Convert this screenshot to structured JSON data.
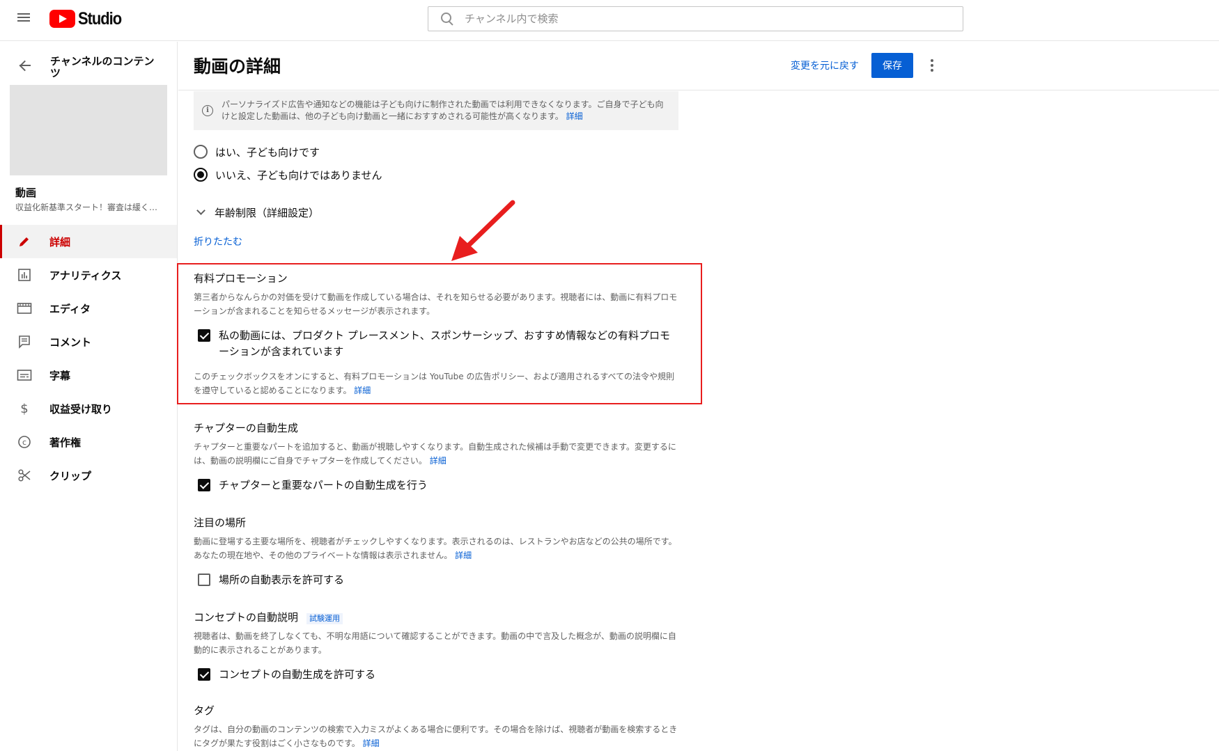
{
  "topbar": {
    "logo_text": "Studio",
    "search_placeholder": "チャンネル内で検索"
  },
  "sidebar": {
    "back_title": "チャンネルのコンテンツ",
    "video_label": "動画",
    "video_subtitle": "収益化新基準スタート！審査は緩く…",
    "items": [
      {
        "label": "詳細",
        "icon": "pencil-icon",
        "active": true
      },
      {
        "label": "アナリティクス",
        "icon": "analytics-icon",
        "active": false
      },
      {
        "label": "エディタ",
        "icon": "editor-icon",
        "active": false
      },
      {
        "label": "コメント",
        "icon": "comment-icon",
        "active": false
      },
      {
        "label": "字幕",
        "icon": "subtitles-icon",
        "active": false
      },
      {
        "label": "収益受け取り",
        "icon": "dollar-icon",
        "active": false
      },
      {
        "label": "著作権",
        "icon": "copyright-icon",
        "active": false
      },
      {
        "label": "クリップ",
        "icon": "scissors-icon",
        "active": false
      }
    ]
  },
  "header": {
    "title": "動画の詳細",
    "undo_label": "変更を元に戻す",
    "save_label": "保存"
  },
  "audience": {
    "info_text": "パーソナライズド広告や通知などの機能は子ども向けに制作された動画では利用できなくなります。ご自身で子ども向けと設定した動画は、他の子ども向け動画と一緒におすすめされる可能性が高くなります。",
    "info_link": "詳細",
    "yes_label": "はい、子ども向けです",
    "no_label": "いいえ、子ども向けではありません",
    "selected": "no",
    "age_restriction_label": "年齢制限（詳細設定）",
    "collapse_label": "折りたたむ"
  },
  "paid_promotion": {
    "title": "有料プロモーション",
    "description": "第三者からなんらかの対価を受けて動画を作成している場合は、それを知らせる必要があります。視聴者には、動画に有料プロモーションが含まれることを知らせるメッセージが表示されます。",
    "checkbox_label": "私の動画には、プロダクト プレースメント、スポンサーシップ、おすすめ情報などの有料プロモーションが含まれています",
    "checked": true,
    "note": "このチェックボックスをオンにすると、有料プロモーションは YouTube の広告ポリシー、および適用されるすべての法令や規則を遵守していると認めることになります。",
    "note_link": "詳細"
  },
  "chapters": {
    "title": "チャプターの自動生成",
    "description": "チャプターと重要なパートを追加すると、動画が視聴しやすくなります。自動生成された候補は手動で変更できます。変更するには、動画の説明欄にご自身でチャプターを作成してください。",
    "link": "詳細",
    "checkbox_label": "チャプターと重要なパートの自動生成を行う",
    "checked": true
  },
  "places": {
    "title": "注目の場所",
    "description": "動画に登場する主要な場所を、視聴者がチェックしやすくなります。表示されるのは、レストランやお店などの公共の場所です。あなたの現在地や、その他のプライベートな情報は表示されません。",
    "link": "詳細",
    "checkbox_label": "場所の自動表示を許可する",
    "checked": false
  },
  "concepts": {
    "title": "コンセプトの自動説明",
    "badge": "試験運用",
    "description": "視聴者は、動画を終了しなくても、不明な用語について確認することができます。動画の中で言及した概念が、動画の説明欄に自動的に表示されることがあります。",
    "checkbox_label": "コンセプトの自動生成を許可する",
    "checked": true
  },
  "tags": {
    "title": "タグ",
    "description": "タグは、自分の動画のコンテンツの検索で入力ミスがよくある場合に便利です。その場合を除けば、視聴者が動画を検索するときにタグが果たす役割はごく小さなものです。",
    "link": "詳細"
  },
  "colors": {
    "accent": "#065fd4",
    "brand_red": "#ff0000",
    "active_red": "#cc0000",
    "highlight_red": "#e81e1e"
  }
}
